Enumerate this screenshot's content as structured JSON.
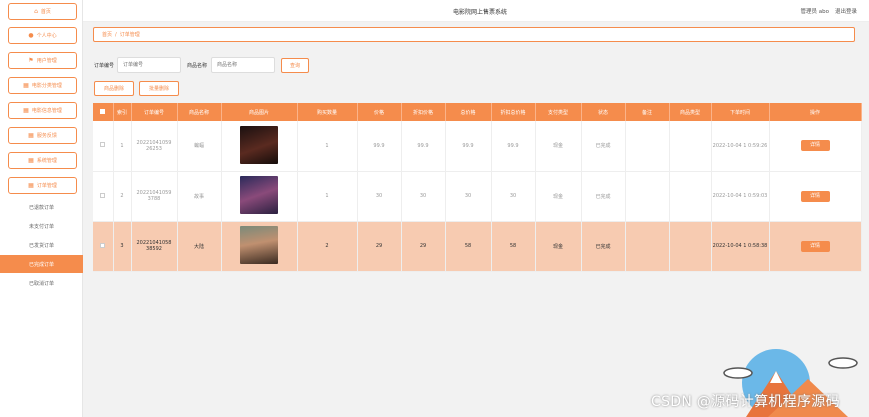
{
  "app": {
    "title": "电影院网上售票系统"
  },
  "header": {
    "user": "管理员 abo",
    "logout": "退出登录"
  },
  "sidebar": {
    "items": [
      {
        "label": "首页",
        "icon": "home-icon"
      },
      {
        "label": "个人中心",
        "icon": "user-icon"
      },
      {
        "label": "用户管理",
        "icon": "flag-icon"
      },
      {
        "label": "电影分类管理",
        "icon": "grid-icon"
      },
      {
        "label": "电影信息管理",
        "icon": "grid-icon"
      },
      {
        "label": "服务反馈",
        "icon": "grid-icon"
      },
      {
        "label": "系统管理",
        "icon": "grid-icon"
      },
      {
        "label": "订单管理",
        "icon": "grid-icon"
      }
    ],
    "subitems": [
      {
        "label": "已退款订单",
        "active": false
      },
      {
        "label": "未支付订单",
        "active": false
      },
      {
        "label": "已发货订单",
        "active": false
      },
      {
        "label": "已完成订单",
        "active": true
      },
      {
        "label": "已取消订单",
        "active": false
      }
    ]
  },
  "breadcrumb": {
    "home": "首页",
    "separator": "/",
    "current": "订单管理"
  },
  "search": {
    "order_label": "订单编号",
    "order_placeholder": "订单编号",
    "name_label": "商品名称",
    "name_placeholder": "商品名称",
    "search_button": "查询",
    "delete_button": "商品删除",
    "export_button": "批量删除"
  },
  "table": {
    "columns": [
      "",
      "索引",
      "订单编号",
      "商品名称",
      "商品图片",
      "购买数量",
      "价格",
      "折扣价格",
      "总价格",
      "折扣总价格",
      "支付类型",
      "状态",
      "备注",
      "商品类型",
      "下单时间",
      "操作"
    ],
    "rows": [
      {
        "index": "1",
        "order_no": "20221041059 26253",
        "name": "蝙蝠",
        "qty": "1",
        "price": "99.9",
        "discount_price": "99.9",
        "total": "99.9",
        "discount_total": "99.9",
        "pay_type": "现金",
        "status": "已完成",
        "note": "",
        "type": "",
        "time": "2022-10-04 1 0:59:26",
        "action": "详情",
        "poster_color": "#2b1c1a",
        "highlight": false
      },
      {
        "index": "2",
        "order_no": "20221041059 3788",
        "name": "故事",
        "qty": "1",
        "price": "30",
        "discount_price": "30",
        "total": "30",
        "discount_total": "30",
        "pay_type": "现金",
        "status": "已完成",
        "note": "",
        "type": "",
        "time": "2022-10-04 1 0:59:03",
        "action": "详情",
        "poster_color": "#3b2e58",
        "highlight": false
      },
      {
        "index": "3",
        "order_no": "20221041058 38592",
        "name": "大陆",
        "qty": "2",
        "price": "29",
        "discount_price": "29",
        "total": "58",
        "discount_total": "58",
        "pay_type": "现金",
        "status": "已完成",
        "note": "",
        "type": "",
        "time": "2022-10-04 1 0:58:38",
        "action": "详情",
        "poster_color": "#5a4a3a",
        "highlight": true
      }
    ]
  },
  "watermark": "CSDN @源码计算机程序源码",
  "colors": {
    "accent": "#f58c4c",
    "highlight_row": "#f7cbb1"
  }
}
